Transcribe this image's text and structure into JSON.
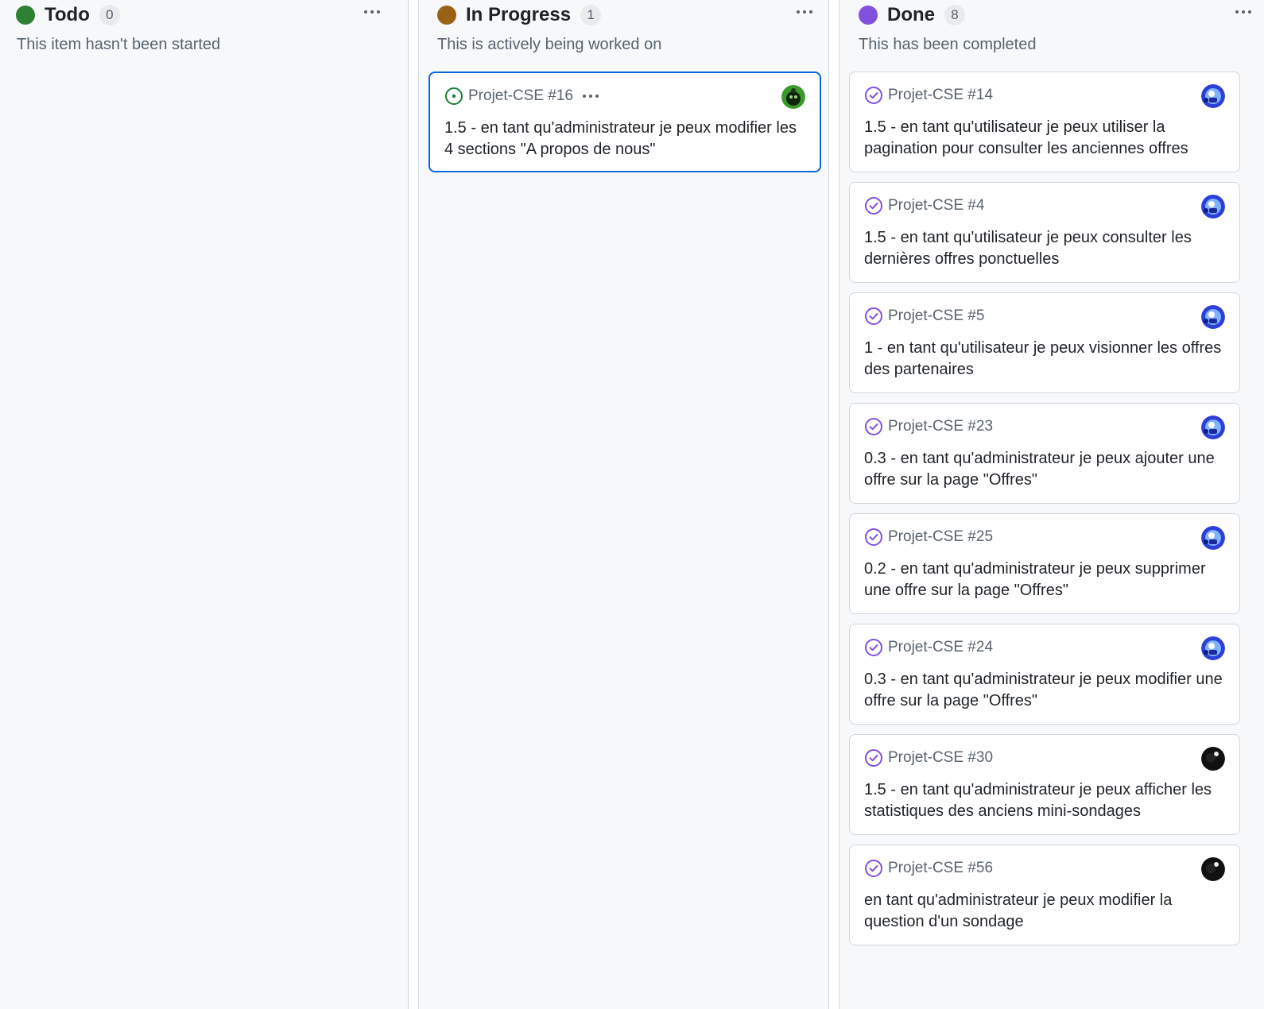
{
  "colors": {
    "todo": "#2f8132",
    "in_progress": "#9a6114",
    "done": "#8250df",
    "open_issue": "#1a7f37",
    "selected_border": "#0969da"
  },
  "columns": [
    {
      "title": "Todo",
      "count": "0",
      "description": "This item hasn't been started",
      "cards": []
    },
    {
      "title": "In Progress",
      "count": "1",
      "description": "This is actively being worked on",
      "cards": [
        {
          "ref": "Projet-CSE #16",
          "title": "1.5 - en tant qu'administrateur je peux modifier les 4 sections \"A propos de nous\"",
          "state": "open",
          "avatar": "green-avatar"
        }
      ]
    },
    {
      "title": "Done",
      "count": "8",
      "description": "This has been completed",
      "cards": [
        {
          "ref": "Projet-CSE #14",
          "title": "1.5 - en tant qu'utilisateur je peux utiliser la pagination pour consulter les anciennes offres",
          "state": "closed",
          "avatar": "blue-avatar"
        },
        {
          "ref": "Projet-CSE #4",
          "title": "1.5 - en tant qu'utilisateur je peux consulter les dernières offres ponctuelles",
          "state": "closed",
          "avatar": "blue-avatar"
        },
        {
          "ref": "Projet-CSE #5",
          "title": "1 - en tant qu'utilisateur je peux visionner les offres des partenaires",
          "state": "closed",
          "avatar": "blue-avatar"
        },
        {
          "ref": "Projet-CSE #23",
          "title": "0.3 - en tant qu'administrateur je peux ajouter une offre sur la page \"Offres\"",
          "state": "closed",
          "avatar": "blue-avatar"
        },
        {
          "ref": "Projet-CSE #25",
          "title": "0.2 - en tant qu'administrateur je peux supprimer une offre sur la page \"Offres\"",
          "state": "closed",
          "avatar": "blue-avatar"
        },
        {
          "ref": "Projet-CSE #24",
          "title": "0.3 - en tant qu'administrateur je peux modifier une offre sur la page \"Offres\"",
          "state": "closed",
          "avatar": "blue-avatar"
        },
        {
          "ref": "Projet-CSE #30",
          "title": "1.5 - en tant qu'administrateur je peux afficher les statistiques des anciens mini-sondages",
          "state": "closed",
          "avatar": "black-avatar"
        },
        {
          "ref": "Projet-CSE #56",
          "title": "en tant qu'administrateur je peux modifier la question d'un sondage",
          "state": "closed",
          "avatar": "black-avatar"
        }
      ]
    }
  ]
}
